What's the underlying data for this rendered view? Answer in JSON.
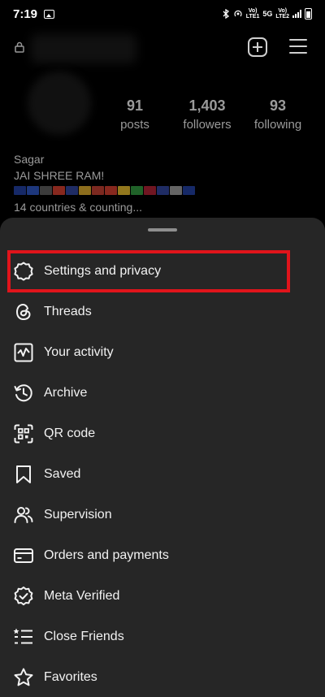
{
  "status_bar": {
    "time": "7:19",
    "indicators": [
      "bluetooth",
      "hotspot",
      "Vo) LTE1",
      "5G",
      "Vo) LTE2",
      "signal",
      "battery"
    ],
    "sim1_text": "Vo)\nLTE1",
    "net_text": "5G",
    "sim2_text": "Vo)\nLTE2"
  },
  "profile": {
    "stats": [
      {
        "value": "91",
        "label": "posts"
      },
      {
        "value": "1,403",
        "label": "followers"
      },
      {
        "value": "93",
        "label": "following"
      }
    ],
    "name": "Sagar",
    "tagline": "JAI SHREE RAM!",
    "countries_line": "14 countries & counting..."
  },
  "menu": {
    "items": [
      {
        "label": "Settings and privacy",
        "icon": "settings-icon"
      },
      {
        "label": "Threads",
        "icon": "threads-icon"
      },
      {
        "label": "Your activity",
        "icon": "activity-icon"
      },
      {
        "label": "Archive",
        "icon": "archive-icon"
      },
      {
        "label": "QR code",
        "icon": "qr-code-icon"
      },
      {
        "label": "Saved",
        "icon": "bookmark-icon"
      },
      {
        "label": "Supervision",
        "icon": "supervision-icon"
      },
      {
        "label": "Orders and payments",
        "icon": "card-icon"
      },
      {
        "label": "Meta Verified",
        "icon": "verified-badge-icon"
      },
      {
        "label": "Close Friends",
        "icon": "close-friends-icon"
      },
      {
        "label": "Favorites",
        "icon": "star-icon"
      }
    ],
    "highlighted_item": "Settings and privacy"
  },
  "colors": {
    "sheet_background": "#262626",
    "highlight_border": "#e0141b",
    "page_background": "#000000"
  }
}
